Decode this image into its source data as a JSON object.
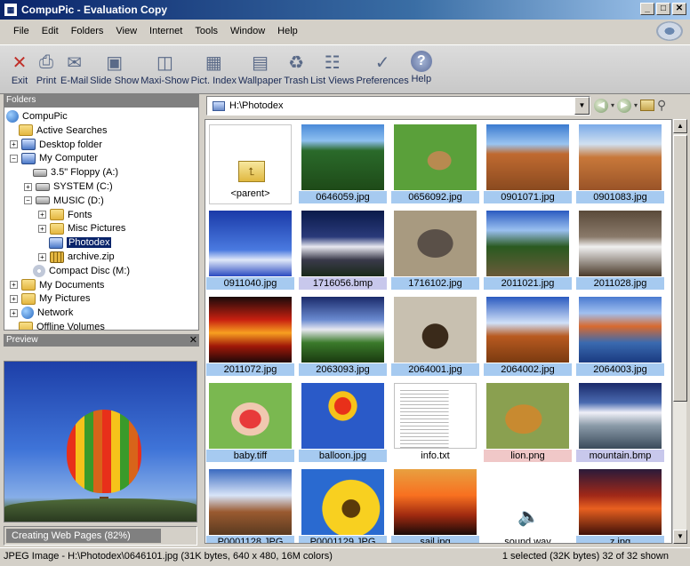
{
  "window": {
    "title": "CompuPic - Evaluation Copy"
  },
  "menu": [
    "File",
    "Edit",
    "Folders",
    "View",
    "Internet",
    "Tools",
    "Window",
    "Help"
  ],
  "toolbar": [
    {
      "label": "Exit",
      "icon": "exit-icon",
      "glyph": "✕"
    },
    {
      "label": "Print",
      "icon": "printer-icon",
      "glyph": "⎙"
    },
    {
      "label": "E-Mail",
      "icon": "envelope-icon",
      "glyph": "✉"
    },
    {
      "label": "Slide Show",
      "icon": "slideshow-icon",
      "glyph": "▣"
    },
    {
      "label": "Maxi-Show",
      "icon": "maxishow-icon",
      "glyph": "◫"
    },
    {
      "label": "Pict. Index",
      "icon": "picture-index-icon",
      "glyph": "▦"
    },
    {
      "label": "Wallpaper",
      "icon": "wallpaper-icon",
      "glyph": "▤"
    },
    {
      "label": "Trash",
      "icon": "trash-icon",
      "glyph": "♻"
    },
    {
      "label": "List Views",
      "icon": "list-views-icon",
      "glyph": "☷"
    },
    {
      "label": "Preferences",
      "icon": "preferences-icon",
      "glyph": "✓"
    },
    {
      "label": "Help",
      "icon": "help-icon",
      "glyph": "?"
    }
  ],
  "folders_panel": {
    "title": "Folders",
    "items": [
      {
        "label": "CompuPic",
        "icon": "globe",
        "expander": ""
      },
      {
        "label": "Active Searches",
        "icon": "folder",
        "expander": ""
      },
      {
        "label": "Desktop folder",
        "icon": "comp",
        "expander": "+"
      },
      {
        "label": "My Computer",
        "icon": "comp",
        "expander": "−"
      },
      {
        "label": "3.5\" Floppy (A:)",
        "icon": "drive",
        "expander": ""
      },
      {
        "label": "SYSTEM (C:)",
        "icon": "drive",
        "expander": "+"
      },
      {
        "label": "MUSIC (D:)",
        "icon": "drive",
        "expander": "−"
      },
      {
        "label": "Fonts",
        "icon": "folder",
        "expander": "+"
      },
      {
        "label": "Misc Pictures",
        "icon": "folder",
        "expander": "+"
      },
      {
        "label": "Photodex",
        "icon": "comp",
        "expander": "",
        "selected": true
      },
      {
        "label": "archive.zip",
        "icon": "zip",
        "expander": "+"
      },
      {
        "label": "Compact Disc (M:)",
        "icon": "cd",
        "expander": ""
      },
      {
        "label": "My Documents",
        "icon": "folder",
        "expander": "+"
      },
      {
        "label": "My Pictures",
        "icon": "folder",
        "expander": "+"
      },
      {
        "label": "Network",
        "icon": "globe",
        "expander": "+"
      },
      {
        "label": "Offline Volumes",
        "icon": "folder",
        "expander": ""
      }
    ]
  },
  "preview_panel": {
    "title": "Preview"
  },
  "progress": {
    "label": "Creating Web Pages (82%)",
    "fraction": 0.82
  },
  "path": {
    "value": "H:\\Photodex"
  },
  "files": [
    {
      "name": "<parent>",
      "kind": "parent",
      "caption": "none"
    },
    {
      "name": "0646059.jpg",
      "kind": "image",
      "caption": "hl",
      "bg": "linear-gradient(180deg,#4a8ad8 0%,#8ec0f0 25%,#2a6a2a 40%,#1e4a18 100%)"
    },
    {
      "name": "0656092.jpg",
      "kind": "image",
      "caption": "hl",
      "bg": "radial-gradient(ellipse at 55% 55%,#b88a50 0 18%,#5aa03a 19% 100%)"
    },
    {
      "name": "0901071.jpg",
      "kind": "image",
      "caption": "hl",
      "bg": "linear-gradient(180deg,#3a7ad0 0%,#9ac4f0 30%,#c06a30 45%,#8a4a20 100%)"
    },
    {
      "name": "0901083.jpg",
      "kind": "image",
      "caption": "hl",
      "bg": "linear-gradient(180deg,#7aaae8 0%,#d0e0f0 30%,#c8783a 50%,#9a5428 100%)"
    },
    {
      "name": "0911040.jpg",
      "kind": "image",
      "caption": "hl",
      "bg": "linear-gradient(180deg,#1a3aa8 0%,#4a7ae0 60%,#e0e8f8 75%,#2a4ac0 100%)"
    },
    {
      "name": "1716056.bmp",
      "kind": "image",
      "caption": "hl-lav",
      "bg": "linear-gradient(180deg,#0a1a4a 0%,#2a3a7a 40%,#e8e8f0 55%,#3a3a4a 75%,#1a2a1a 100%)"
    },
    {
      "name": "1716102.jpg",
      "kind": "image",
      "caption": "hl",
      "bg": "radial-gradient(ellipse at 50% 50%,#5a5048 0 30%,#a89a80 31% 100%)"
    },
    {
      "name": "2011021.jpg",
      "kind": "image",
      "caption": "hl",
      "bg": "linear-gradient(180deg,#2a5ac0 0%,#9ac0f0 30%,#2a5a20 55%,#6a5a3a 100%)"
    },
    {
      "name": "2011028.jpg",
      "kind": "image",
      "caption": "hl",
      "bg": "linear-gradient(180deg,#5a4a3a 0%,#8a7a6a 40%,#f0f0f0 55%,#4a3a2a 100%)"
    },
    {
      "name": "2011072.jpg",
      "kind": "image",
      "caption": "hl",
      "bg": "linear-gradient(180deg,#1a0a0a 0%,#c82010 35%,#f8a020 55%,#a01808 75%,#200808 100%)"
    },
    {
      "name": "2063093.jpg",
      "kind": "image",
      "caption": "hl",
      "bg": "linear-gradient(180deg,#1a2a6a 0%,#6a8ad0 35%,#e8e8f0 50%,#3a7a2a 70%,#1a3a10 100%)"
    },
    {
      "name": "2064001.jpg",
      "kind": "image",
      "caption": "hl",
      "bg": "radial-gradient(ellipse at 50% 60%,#3a2a1a 0 22%,#c8c0b0 23% 100%)"
    },
    {
      "name": "2064002.jpg",
      "kind": "image",
      "caption": "hl",
      "bg": "linear-gradient(180deg,#2a5ac0 0%,#d0e0f8 40%,#b85a20 60%,#7a3a10 100%)"
    },
    {
      "name": "2064003.jpg",
      "kind": "image",
      "caption": "hl",
      "bg": "linear-gradient(180deg,#4a7ad0 0%,#a0c0f0 25%,#d86a30 45%,#3a6ab0 70%,#1a3a80 100%)"
    },
    {
      "name": "baby.tiff",
      "kind": "image",
      "caption": "hl",
      "bg": "radial-gradient(ellipse at 50% 55%,#e83a3a 0 18%,#f0c8b0 19% 32%,#7ab850 33% 100%)"
    },
    {
      "name": "balloon.jpg",
      "kind": "image",
      "caption": "hl",
      "bg": "radial-gradient(ellipse at 50% 35%,#e8301a 0 14%,#f6c21a 15% 24%,#2a5ac8 25% 100%)"
    },
    {
      "name": "info.txt",
      "kind": "doc",
      "caption": "none"
    },
    {
      "name": "lion.png",
      "kind": "image",
      "caption": "hl-pink",
      "bg": "radial-gradient(ellipse at 45% 55%,#c88a30 0 28%,#8aa050 29% 100%)"
    },
    {
      "name": "mountain.bmp",
      "kind": "image",
      "caption": "hl-lav",
      "bg": "linear-gradient(180deg,#1a2a6a 0%,#4a6ab0 30%,#f0f0f8 45%,#8a9aa8 65%,#3a4a5a 100%)"
    },
    {
      "name": "P0001128.JPG",
      "kind": "image",
      "caption": "hl",
      "bg": "linear-gradient(180deg,#3a6ac0 0%,#d8e4f8 40%,#9a5a30 65%,#5a3a20 100%)"
    },
    {
      "name": "P0001129.JPG",
      "kind": "image",
      "caption": "hl",
      "bg": "radial-gradient(circle at 60% 60%,#5a3a0a 0 14%,#f8d020 15% 45%,#2a6ad0 46% 100%)"
    },
    {
      "name": "sail.jpg",
      "kind": "image",
      "caption": "hl",
      "bg": "linear-gradient(180deg,#e8a040 0%,#f87020 40%,#a02a10 70%,#1a0a08 100%)"
    },
    {
      "name": "sound.wav",
      "kind": "sound",
      "caption": "none"
    },
    {
      "name": "z.jpg",
      "kind": "image",
      "caption": "hl",
      "bg": "linear-gradient(180deg,#2a1a3a 0%,#a02818 40%,#e86020 60%,#401008 100%)"
    }
  ],
  "status": {
    "left": "JPEG Image - H:\\Photodex\\0646101.jpg  (31K bytes, 640 x 480, 16M colors)",
    "right": "1 selected (32K bytes) 32 of 32 shown"
  }
}
